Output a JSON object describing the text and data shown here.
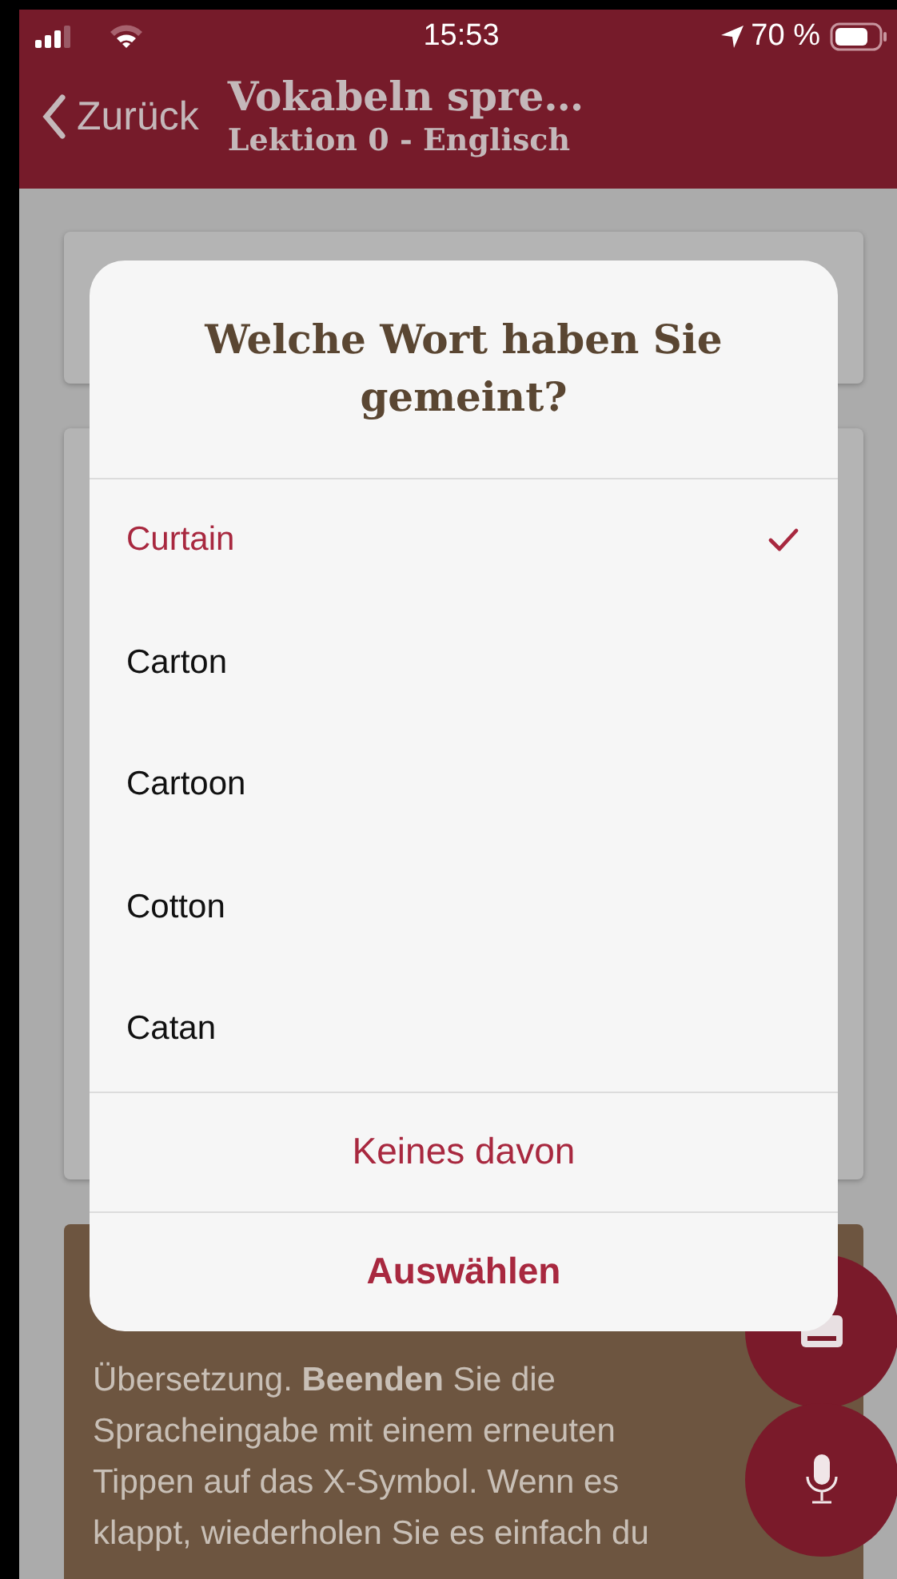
{
  "status_bar": {
    "time": "15:53",
    "battery": "70 %"
  },
  "nav": {
    "back": "Zurück",
    "title": "Vokabeln spre…",
    "subtitle": "Lektion 0 - Englisch"
  },
  "hint_card": {
    "text": "Übersetzung. **Beenden** Sie die Spracheingabe mit einem erneuten Tippen auf das X-Symbol. Wenn es klappt, wiederholen Sie es einfach du"
  },
  "dialog": {
    "title": "Welche Wort haben Sie gemeint?",
    "options": [
      {
        "label": "Curtain",
        "selected": true
      },
      {
        "label": "Carton",
        "selected": false
      },
      {
        "label": "Cartoon",
        "selected": false
      },
      {
        "label": "Cotton",
        "selected": false
      },
      {
        "label": "Catan",
        "selected": false
      }
    ],
    "secondary_action": "Keines davon",
    "primary_action": "Auswählen"
  }
}
